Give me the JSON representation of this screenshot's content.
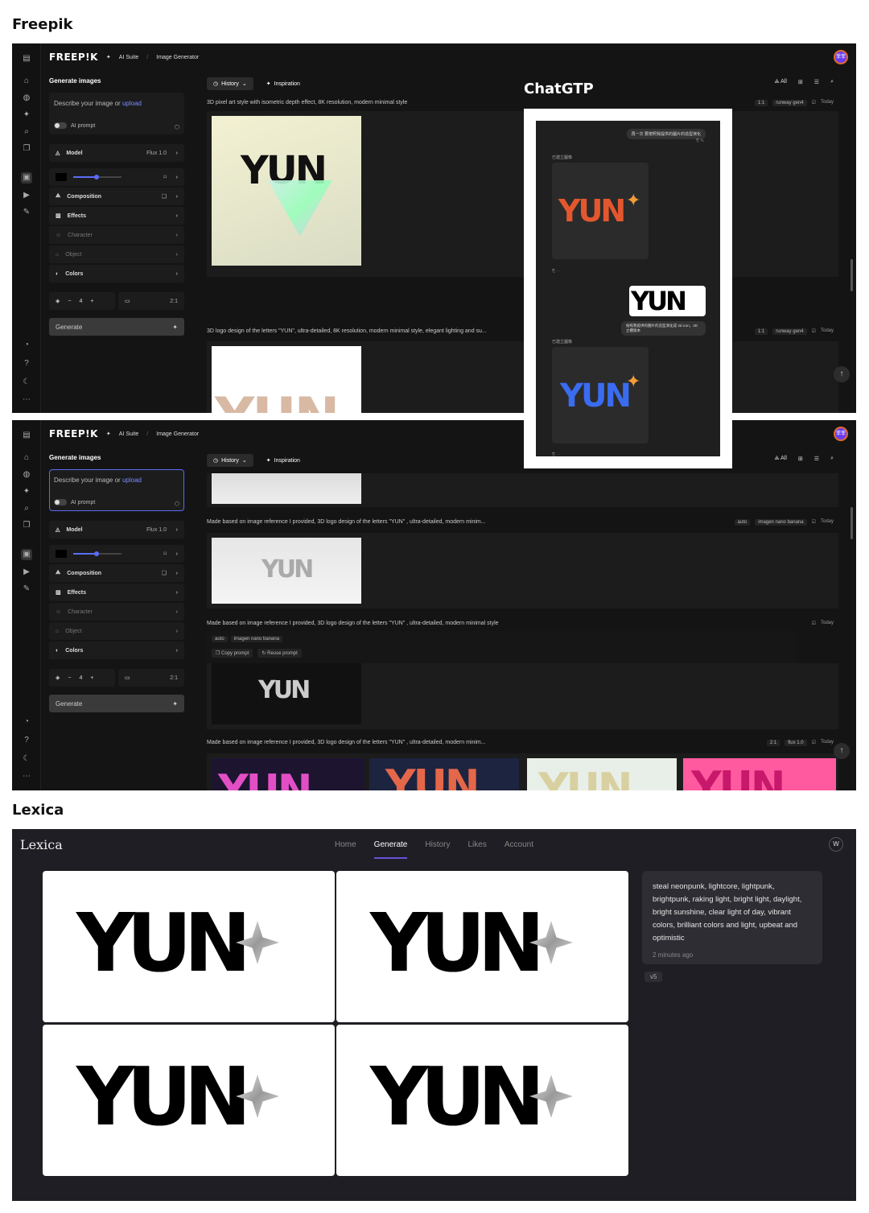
{
  "sections": {
    "freepik_title": "Freepik",
    "lexica_title": "Lexica",
    "chatgpt_title": "ChatGTP"
  },
  "app": {
    "logo": "FREEP!K",
    "breadcrumb_suite": "AI Suite",
    "breadcrumb_sep": "/",
    "breadcrumb_page": "Image Generator",
    "avatar": "菲菲"
  },
  "panel": {
    "title": "Generate images",
    "prompt_placeholder": "Describe your image or",
    "prompt_upload": "upload",
    "ai_prompt": "AI prompt",
    "model_label": "Model",
    "model_value": "Flux 1.0",
    "composition": "Composition",
    "effects": "Effects",
    "character": "Character",
    "object": "Object",
    "colors": "Colors",
    "count": "4",
    "minus": "−",
    "plus": "+",
    "ratio": "2:1",
    "generate": "Generate"
  },
  "toolbar": {
    "history": "History",
    "inspiration": "Inspiration",
    "all": "All"
  },
  "view1": {
    "rows": [
      {
        "prompt": "3D pixel art style with isometric depth effect, 8K resolution, modern minimal style",
        "ratio": "1:1",
        "model": "runway gen4",
        "date": "Today"
      },
      {
        "prompt": "3D logo design of the letters \"YUN\", ultra-detailed, 8K resolution, modern minimal style, elegant lighting and su...",
        "ratio": "1:1",
        "model": "runway gen4",
        "date": "Today"
      }
    ]
  },
  "view2": {
    "rows": [
      {
        "prompt": "Made based on image reference I provided, 3D logo design of the letters \"YUN\" , ultra-detailed, modern minim...",
        "ratio": "auto",
        "model": "imagen nano banana",
        "date": "Today"
      },
      {
        "prompt": "Made based on image reference I provided, 3D logo design of the letters \"YUN\" , ultra-detailed, modern minimal style",
        "ratio": "auto",
        "model": "imagen nano banana",
        "date": "Today"
      },
      {
        "prompt": "Made based on image reference I provided, 3D logo design of the letters \"YUN\" , ultra-detailed, modern minim...",
        "ratio": "2:1",
        "model": "flux 1.0",
        "date": "Today"
      }
    ],
    "copy_prompt": "Copy prompt",
    "reuse_prompt": "Reuse prompt"
  },
  "chat": {
    "user_msg": "再一次 要按照我提供的圖片的造型演化",
    "bot_label1": "已建立圖像",
    "user_msg2": "按照我提供的圖片的造型演化成 3d icon，3D 立體版本",
    "bot_label2": "已建立圖像"
  },
  "lexica": {
    "logo": "Lexica",
    "nav": [
      "Home",
      "Generate",
      "History",
      "Likes",
      "Account"
    ],
    "avatar": "W",
    "prompt": "steal neonpunk, lightcore, lightpunk, brightpunk, raking light, bright light, daylight, bright sunshine, clear light of day, vibrant colors, brilliant colors and light, upbeat and optimistic",
    "time": "2 minutes ago",
    "version": "v5"
  },
  "yun": "YUN",
  "colors": {
    "accent": "#5a6cf5",
    "lexica_accent": "#6a4fd8"
  }
}
